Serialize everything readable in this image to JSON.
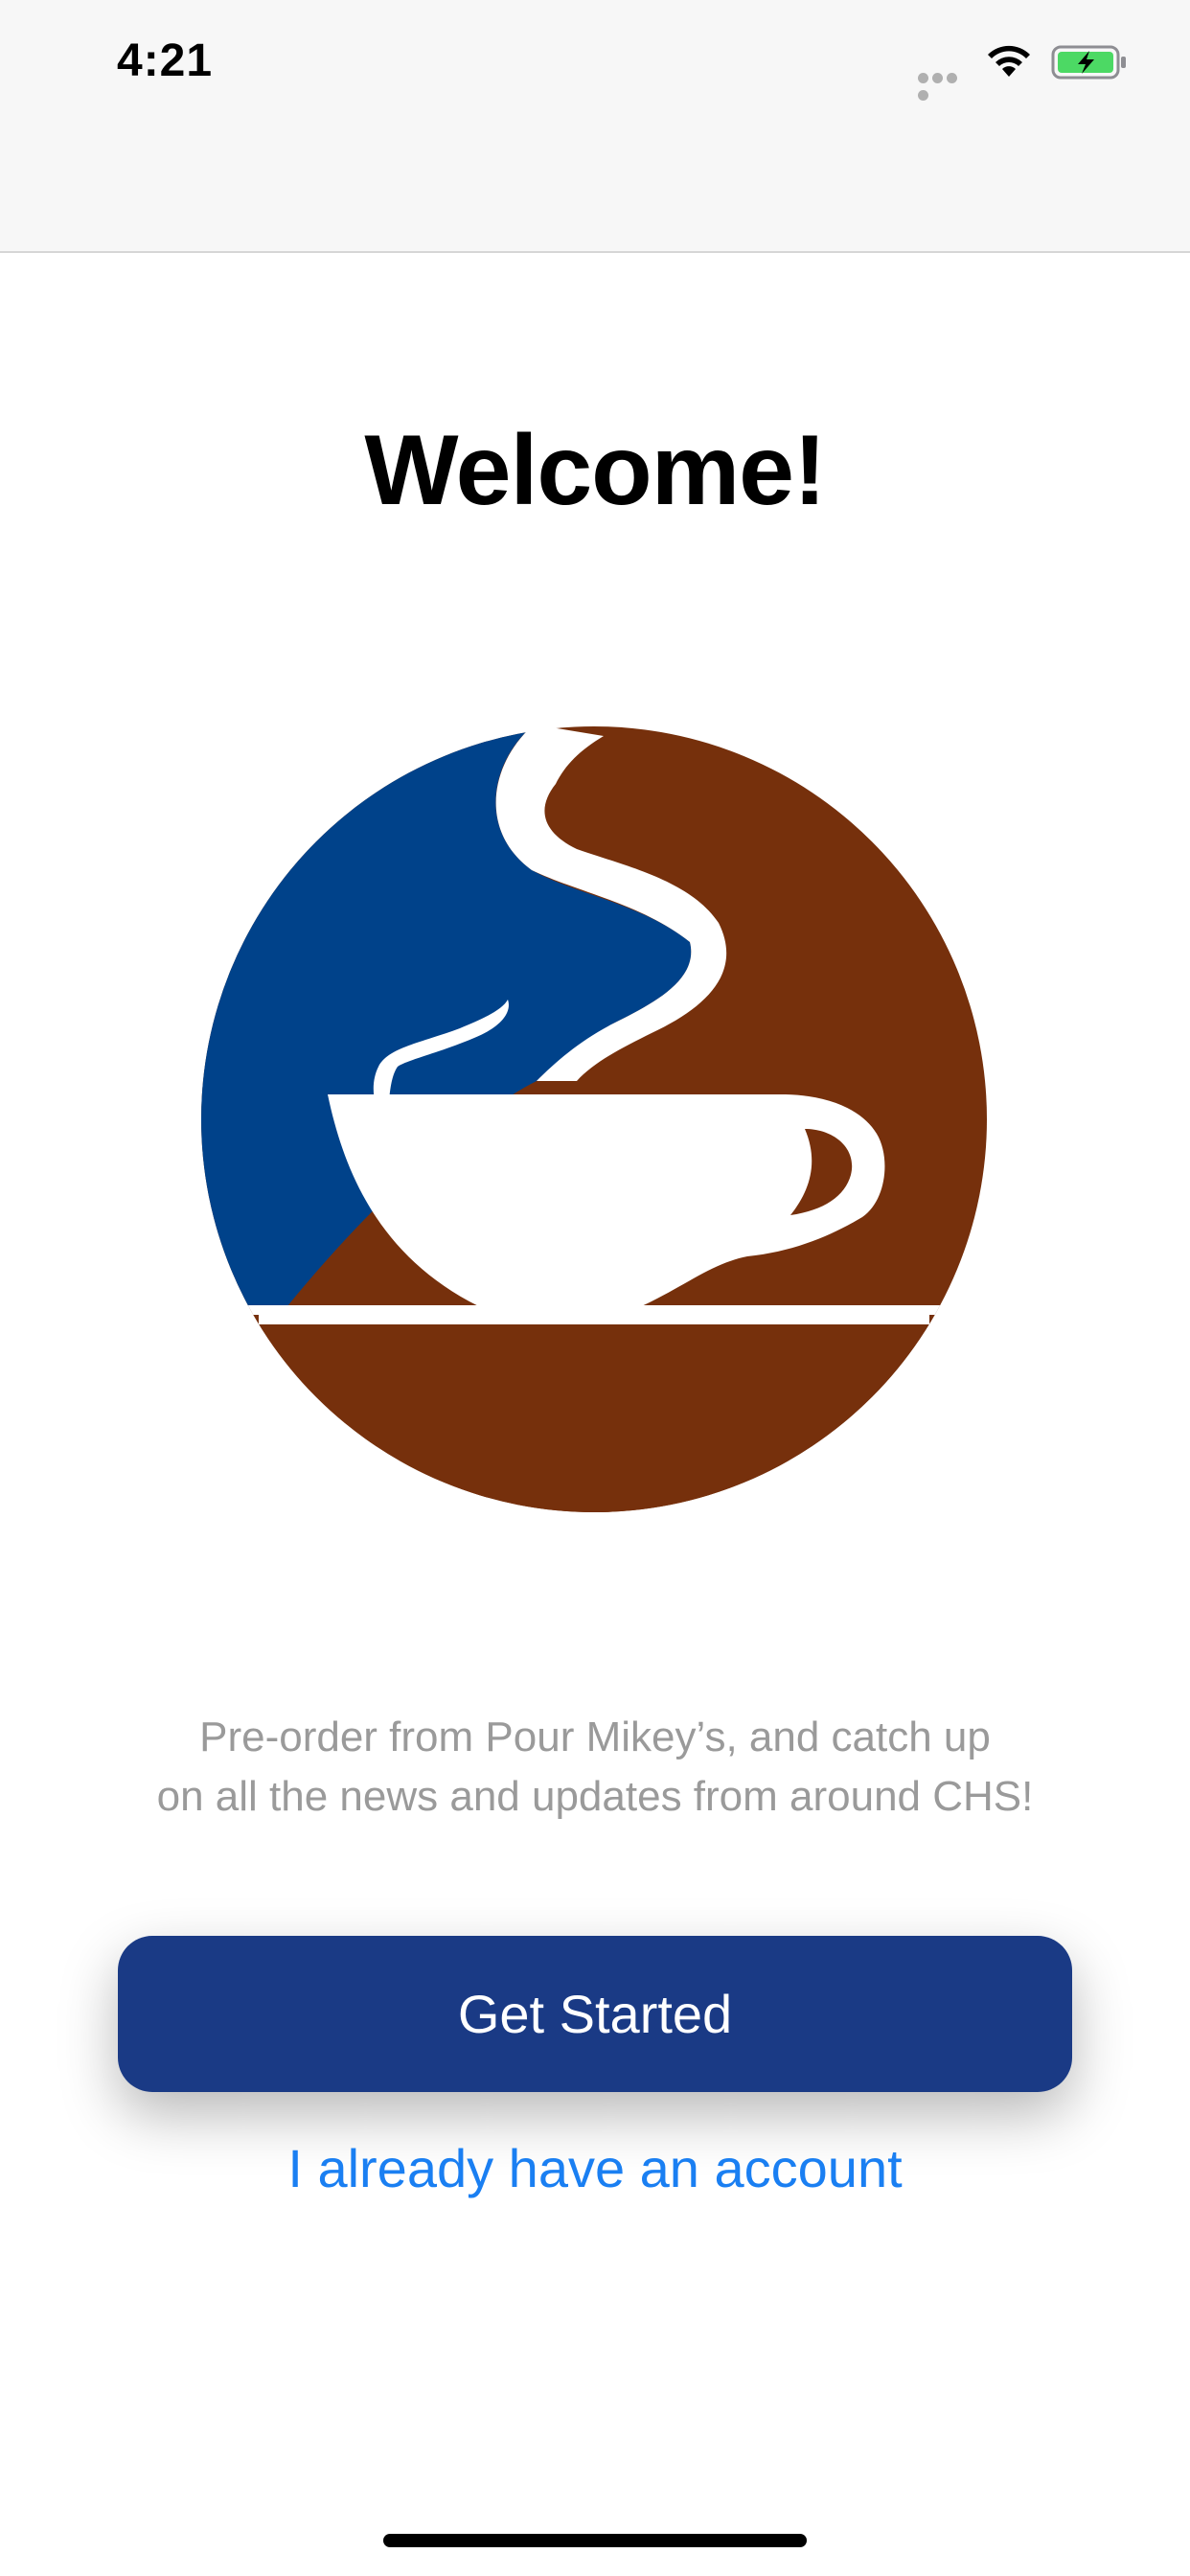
{
  "status_bar": {
    "time": "4:21",
    "icons": [
      "signal-dots-icon",
      "wifi-icon",
      "battery-charging-icon"
    ]
  },
  "welcome": {
    "title": "Welcome!",
    "logo_icon": "coffee-cup-logo-icon",
    "tagline_line1": "Pre-order from Pour Mikey’s, and catch up",
    "tagline_line2": "on all the news and updates from around CHS!"
  },
  "actions": {
    "get_started_label": "Get Started",
    "login_link_label": "I already have an account"
  },
  "colors": {
    "primary_button": "#1a3a85",
    "link": "#1a7ff2",
    "logo_blue": "#00428a",
    "logo_brown": "#76300c",
    "battery_green": "#4cd964",
    "tagline_gray": "#9a9a9a"
  }
}
